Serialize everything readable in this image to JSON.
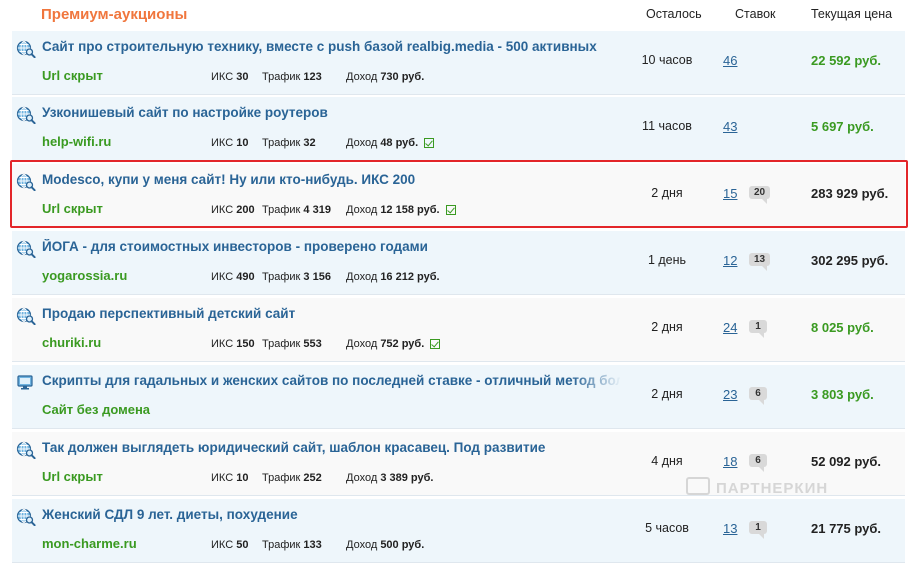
{
  "header": {
    "title": "Премиум-аукционы",
    "col_left": "Осталось",
    "col_bids": "Ставок",
    "col_price": "Текущая цена"
  },
  "labels": {
    "iks": "ИКС",
    "traffic": "Трафик",
    "income": "Доход"
  },
  "rows": [
    {
      "icon": "globe-search-icon",
      "title": "Сайт про строительную технику, вместе с push базой realbig.media - 500 активных",
      "domain": "Url скрыт",
      "iks": "30",
      "traffic": "123",
      "income": "730 руб.",
      "verified": false,
      "time": "10 часов",
      "bids": "46",
      "comments": "",
      "price": "22 592 руб.",
      "price_color": "green"
    },
    {
      "icon": "globe-search-icon",
      "title": "Узконишевый сайт по настройке роутеров",
      "domain": "help-wifi.ru",
      "iks": "10",
      "traffic": "32",
      "income": "48 руб.",
      "verified": true,
      "time": "11 часов",
      "bids": "43",
      "comments": "",
      "price": "5 697 руб.",
      "price_color": "green"
    },
    {
      "icon": "globe-search-icon",
      "title": "Modesco, купи у меня сайт! Ну или кто-нибудь. ИКС 200",
      "domain": "Url скрыт",
      "iks": "200",
      "traffic": "4 319",
      "income": "12 158 руб.",
      "verified": true,
      "time": "2 дня",
      "bids": "15",
      "comments": "20",
      "price": "283 929 руб.",
      "price_color": "dark"
    },
    {
      "icon": "globe-search-icon",
      "title": "ЙОГА - для стоимостных инвесторов - проверено годами",
      "domain": "yogarossia.ru",
      "iks": "490",
      "traffic": "3 156",
      "income": "16 212 руб.",
      "verified": false,
      "time": "1 день",
      "bids": "12",
      "comments": "13",
      "price": "302 295 руб.",
      "price_color": "dark"
    },
    {
      "icon": "globe-search-icon",
      "title": "Продаю перспективный детский сайт",
      "domain": "churiki.ru",
      "iks": "150",
      "traffic": "553",
      "income": "752 руб.",
      "verified": true,
      "time": "2 дня",
      "bids": "24",
      "comments": "1",
      "price": "8 025 руб.",
      "price_color": "green"
    },
    {
      "icon": "monitor-icon",
      "title": "Скрипты для гадальных и женских сайтов по последней ставке - отличный метод боль",
      "domain": "Сайт без домена",
      "iks": "",
      "traffic": "",
      "income": "",
      "verified": false,
      "time": "2 дня",
      "bids": "23",
      "comments": "6",
      "price": "3 803 руб.",
      "price_color": "green"
    },
    {
      "icon": "globe-search-icon",
      "title": "Так должен выглядеть юридический сайт, шаблон красавец. Под развитие",
      "domain": "Url скрыт",
      "iks": "10",
      "traffic": "252",
      "income": "3 389 руб.",
      "verified": false,
      "time": "4 дня",
      "bids": "18",
      "comments": "6",
      "price": "52 092 руб.",
      "price_color": "dark"
    },
    {
      "icon": "globe-search-icon",
      "title": "Женский СДЛ 9 лет. диеты, похудение",
      "domain": "mon-charme.ru",
      "iks": "50",
      "traffic": "133",
      "income": "500 руб.",
      "verified": false,
      "time": "5 часов",
      "bids": "13",
      "comments": "1",
      "price": "21 775 руб.",
      "price_color": "dark"
    }
  ],
  "watermark": "ПАРТНЕРКИН",
  "colors": {
    "accent": "#f0763d",
    "link": "#2a6496",
    "green": "#3a9a21",
    "highlight": "#e3262a"
  }
}
